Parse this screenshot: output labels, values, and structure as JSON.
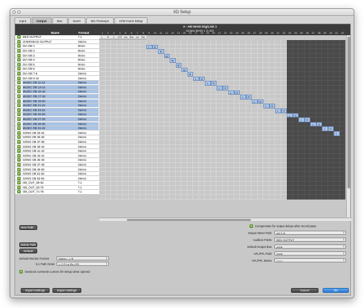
{
  "window": {
    "title": "I/O Setup"
  },
  "tabs": [
    {
      "label": "Input",
      "active": false
    },
    {
      "label": "Output",
      "active": true
    },
    {
      "label": "Bus",
      "active": false
    },
    {
      "label": "Insert",
      "active": false
    },
    {
      "label": "Mic Preamps",
      "active": false
    },
    {
      "label": "H/W Insert Delay",
      "active": false
    }
  ],
  "matrix": {
    "header_line1": "A - HD MADI DigiLink 1",
    "header_line2": "Output MADI 1 (1-32)",
    "col_name": "Name",
    "col_format": "Format",
    "channel_numbers": [
      "1",
      "2",
      "3",
      "4",
      "5",
      "6",
      "7",
      "8",
      "9",
      "10",
      "11",
      "12",
      "13",
      "14",
      "15",
      "16",
      "17",
      "18",
      "19",
      "20",
      "21",
      "22",
      "23",
      "24",
      "25",
      "26",
      "27",
      "28",
      "29",
      "30",
      "31",
      "32",
      "33",
      "34",
      "35",
      "36",
      "37",
      "38",
      "39",
      "40",
      "41",
      "42"
    ],
    "bed_sublabels": [
      "L",
      "R",
      "C",
      "LFE",
      "Lss",
      "Rss",
      "Lsr",
      "Rsr"
    ],
    "rows": [
      {
        "name": "BED OUTPUT",
        "format": "7.1",
        "selected": false
      },
      {
        "name": "OVERHEAD OUTPUT",
        "format": "Stereo",
        "selected": false
      },
      {
        "name": "DIA OB 1",
        "format": "Mono",
        "selected": false
      },
      {
        "name": "DIA OB 2",
        "format": "Mono",
        "selected": false
      },
      {
        "name": "DIA OB 3",
        "format": "Mono",
        "selected": false
      },
      {
        "name": "DIA OB 4",
        "format": "Mono",
        "selected": false
      },
      {
        "name": "DIA OB 5",
        "format": "Mono",
        "selected": false
      },
      {
        "name": "DIA OB 6",
        "format": "Mono",
        "selected": false
      },
      {
        "name": "DIA OB 7-8",
        "format": "Stereo",
        "selected": false
      },
      {
        "name": "DIA OB 9-10",
        "format": "Stereo",
        "selected": false
      },
      {
        "name": "MUSIC OB 11-12",
        "format": "Stereo",
        "selected": true
      },
      {
        "name": "MUSIC OB 13-14",
        "format": "Stereo",
        "selected": true
      },
      {
        "name": "MUSIC OB 15-16",
        "format": "Stereo",
        "selected": true
      },
      {
        "name": "MUSIC OB 17-18",
        "format": "Stereo",
        "selected": true
      },
      {
        "name": "MUSIC OB 19-20",
        "format": "Stereo",
        "selected": true
      },
      {
        "name": "MUSIC OB 21-22",
        "format": "Stereo",
        "selected": true
      },
      {
        "name": "MUSIC OB 23-24",
        "format": "Stereo",
        "selected": true
      },
      {
        "name": "MUSIC OB 25-26",
        "format": "Stereo",
        "selected": true
      },
      {
        "name": "MUSIC OB 27-28",
        "format": "Stereo",
        "selected": true
      },
      {
        "name": "MUSIC OB 29-30",
        "format": "Stereo",
        "selected": true
      },
      {
        "name": "MUSIC OB 31-32",
        "format": "Stereo",
        "selected": true
      },
      {
        "name": "SONG OB 33-34",
        "format": "Stereo",
        "selected": false
      },
      {
        "name": "SONG OB 35-36",
        "format": "Stereo",
        "selected": false
      },
      {
        "name": "SONG OB 37-38",
        "format": "Stereo",
        "selected": false
      },
      {
        "name": "SONG OB 39-40",
        "format": "Stereo",
        "selected": false
      },
      {
        "name": "SONG OB 41-42",
        "format": "Stereo",
        "selected": false
      },
      {
        "name": "SONG OB 43-44",
        "format": "Stereo",
        "selected": false
      },
      {
        "name": "SONG OB 45-46",
        "format": "Stereo",
        "selected": false
      },
      {
        "name": "SONG OB 47-48",
        "format": "Stereo",
        "selected": false
      },
      {
        "name": "SONG OB 49-50",
        "format": "Stereo",
        "selected": false
      },
      {
        "name": "SONG OB 51-52",
        "format": "Stereo",
        "selected": false
      },
      {
        "name": "SONG OB 53-54",
        "format": "Stereo",
        "selected": false
      },
      {
        "name": "OB_OUT_59-62",
        "format": "7.1",
        "selected": false
      },
      {
        "name": "OB_OUT_63-70",
        "format": "7.1",
        "selected": false
      },
      {
        "name": "OB_OUT_71-78",
        "format": "7.1",
        "selected": false
      }
    ],
    "assignments": [
      {
        "row": 1,
        "col": 8,
        "text": "L"
      },
      {
        "row": 1,
        "col": 9,
        "text": "R"
      },
      {
        "row": 2,
        "col": 10,
        "text": "M"
      },
      {
        "row": 3,
        "col": 11,
        "text": "M"
      },
      {
        "row": 4,
        "col": 12,
        "text": "M"
      },
      {
        "row": 5,
        "col": 13,
        "text": "M"
      },
      {
        "row": 6,
        "col": 14,
        "text": "M"
      },
      {
        "row": 7,
        "col": 15,
        "text": "M"
      },
      {
        "row": 8,
        "col": 16,
        "text": "L"
      },
      {
        "row": 8,
        "col": 17,
        "text": "R"
      },
      {
        "row": 9,
        "col": 18,
        "text": "L"
      },
      {
        "row": 9,
        "col": 19,
        "text": "R"
      },
      {
        "row": 10,
        "col": 20,
        "text": "L"
      },
      {
        "row": 10,
        "col": 21,
        "text": "R"
      },
      {
        "row": 11,
        "col": 22,
        "text": "L"
      },
      {
        "row": 11,
        "col": 23,
        "text": "R"
      },
      {
        "row": 12,
        "col": 24,
        "text": "L"
      },
      {
        "row": 12,
        "col": 25,
        "text": "R"
      },
      {
        "row": 13,
        "col": 26,
        "text": "L"
      },
      {
        "row": 13,
        "col": 27,
        "text": "R"
      },
      {
        "row": 14,
        "col": 28,
        "text": "L"
      },
      {
        "row": 14,
        "col": 29,
        "text": "R"
      },
      {
        "row": 15,
        "col": 30,
        "text": "L"
      },
      {
        "row": 15,
        "col": 31,
        "text": "R"
      },
      {
        "row": 16,
        "col": 32,
        "text": "L"
      },
      {
        "row": 16,
        "col": 33,
        "text": "R"
      },
      {
        "row": 17,
        "col": 34,
        "text": "L"
      },
      {
        "row": 17,
        "col": 35,
        "text": "R"
      },
      {
        "row": 18,
        "col": 36,
        "text": "L"
      },
      {
        "row": 18,
        "col": 37,
        "text": "R"
      },
      {
        "row": 19,
        "col": 38,
        "text": "L"
      },
      {
        "row": 19,
        "col": 39,
        "text": "R"
      },
      {
        "row": 20,
        "col": 40,
        "text": "L"
      }
    ]
  },
  "buttons": {
    "new_path": "New Path...",
    "delete_path": "Delete Path",
    "default": "Default",
    "import_settings": "Import Settings",
    "export_settings": "Export Settings",
    "cancel": "Cancel",
    "ok": "OK"
  },
  "left_options": {
    "default_monitor_format_label": "Default Monitor Format",
    "default_monitor_format_value": "Stereo - L R",
    "path_order_label": "5.1 Path Order",
    "path_order_value": "L C R Ls Rs LFE",
    "sessions_overwrite_label": "Sessions overwrite current I/O Setup when opened"
  },
  "right_options": {
    "compensate_label": "Compensate for output delays after record pass",
    "output_meter_path_label": "Output Meter Path",
    "output_meter_path_value": "out 1-8",
    "audition_paths_label": "Audition Paths",
    "audition_paths_value": "BED OUTPUT",
    "default_output_bus_label": "Default Output Bus",
    "default_output_bus_value": "none",
    "afl_pfl_path_label": "AFL/PFL Path",
    "afl_pfl_path_value": "none",
    "afl_pfl_mutes_label": "AFL/PFL Mutes",
    "afl_pfl_mutes_value": "None"
  },
  "icons": {
    "check": "checkmark-icon",
    "arrow": "updown-arrow-icon"
  }
}
